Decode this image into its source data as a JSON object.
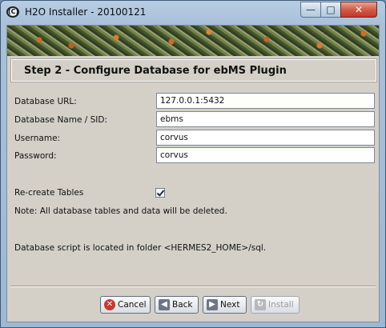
{
  "window": {
    "title": "H2O Installer - 20100121",
    "app_icon_text": "(C)"
  },
  "controls": {
    "minimize": "—",
    "maximize": "□",
    "close": "✕"
  },
  "heading": "Step 2 - Configure Database for ebMS Plugin",
  "form": {
    "database_url": {
      "label": "Database URL:",
      "value": "127.0.0.1:5432"
    },
    "database_name": {
      "label": "Database Name / SID:",
      "value": "ebms"
    },
    "username": {
      "label": "Username:",
      "value": "corvus"
    },
    "password": {
      "label": "Password:",
      "value": "corvus"
    },
    "recreate_tables": {
      "label": "Re-create Tables",
      "checked": true
    }
  },
  "notes": {
    "warning": "Note: All database tables and data will be deleted.",
    "script": "Database script is located in folder <HERMES2_HOME>/sql."
  },
  "buttons": {
    "cancel": {
      "label": "Cancel",
      "icon": "cancel-icon"
    },
    "back": {
      "label": "Back",
      "icon": "back-arrow-icon"
    },
    "next": {
      "label": "Next",
      "icon": "next-arrow-icon"
    },
    "install": {
      "label": "Install",
      "icon": "install-icon",
      "enabled": false
    }
  }
}
